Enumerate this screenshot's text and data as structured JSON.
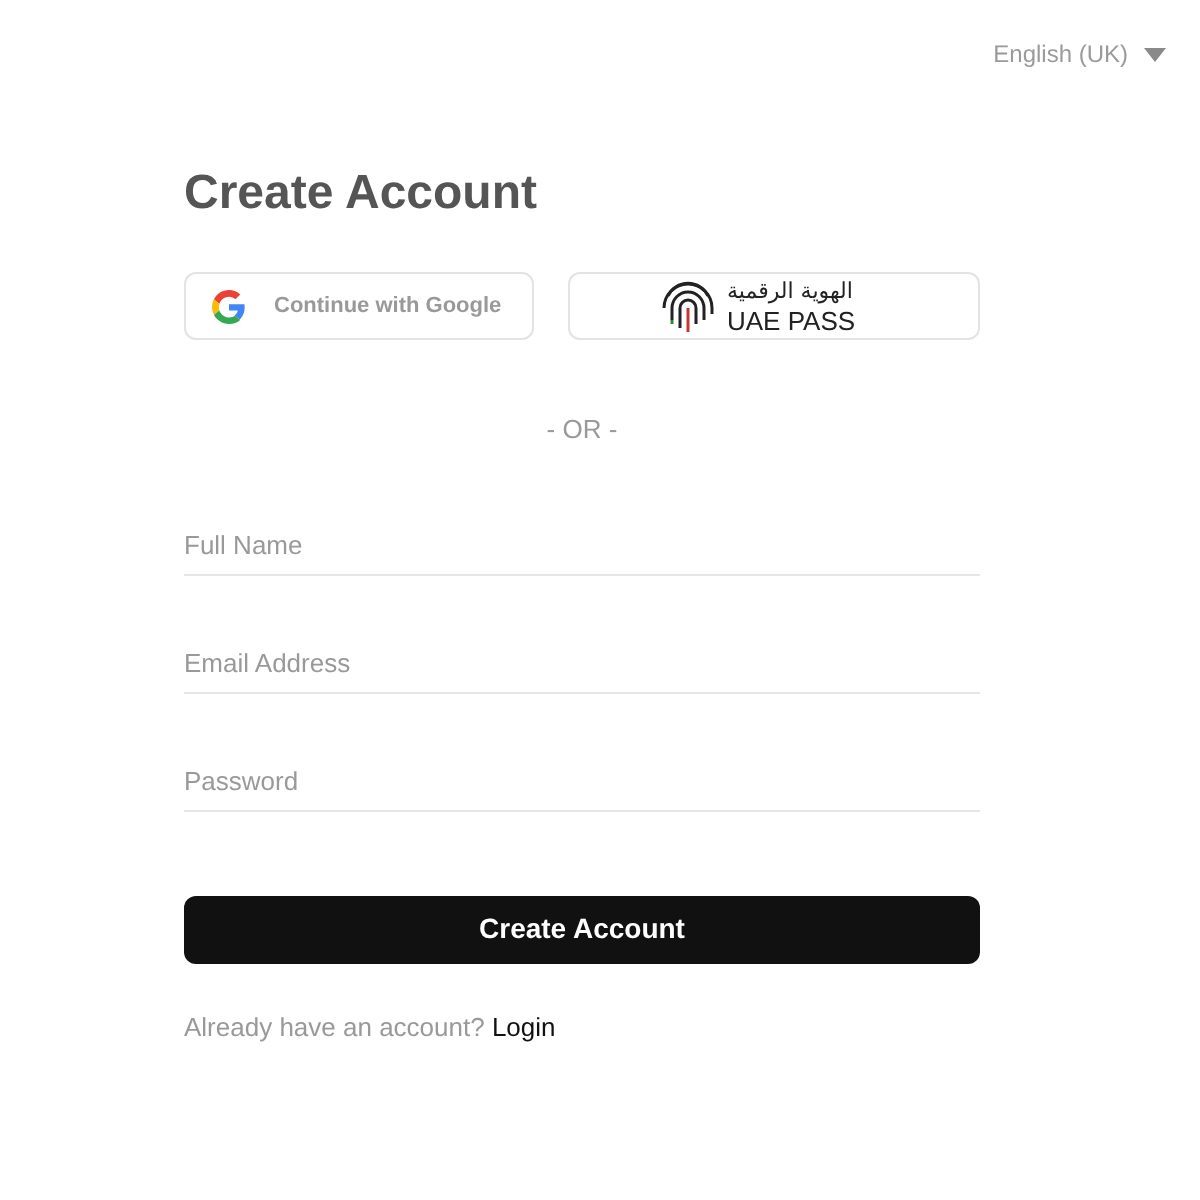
{
  "language": {
    "label": "English (UK)"
  },
  "title": "Create Account",
  "social_buttons": [
    {
      "kind": "google",
      "label": "Continue with Google"
    },
    {
      "kind": "uaepass",
      "label_arabic": "الهوية الرقمية",
      "label": "UAE PASS"
    }
  ],
  "divider": "- OR -",
  "fields": [
    {
      "placeholder": "Full Name"
    },
    {
      "placeholder": "Email Address"
    },
    {
      "placeholder": "Password"
    }
  ],
  "submit": "Create Account",
  "footer": {
    "text": "Already have an account?",
    "link": "Login"
  }
}
